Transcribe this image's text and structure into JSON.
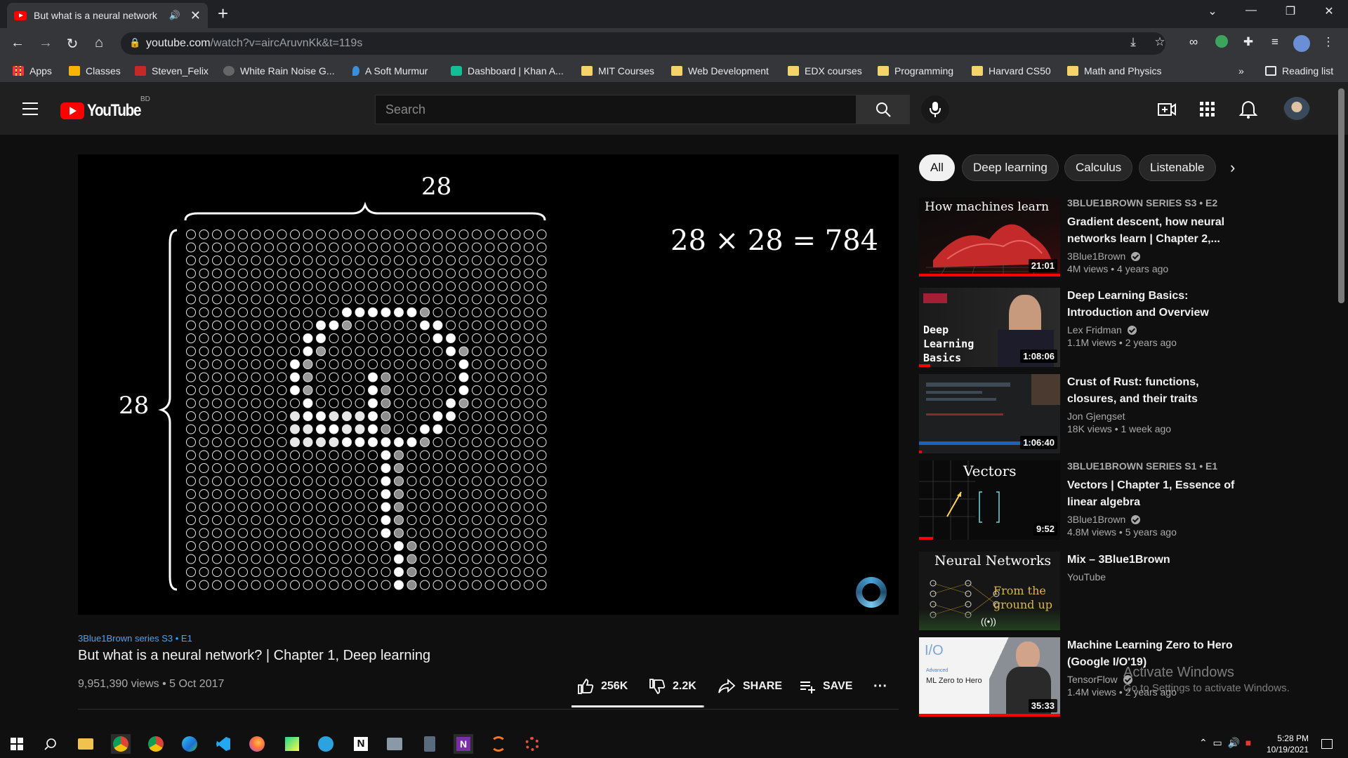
{
  "browser": {
    "tab_title": "But what is a neural network",
    "url_host": "youtube.com",
    "url_path": "/watch?v=aircAruvnKk&t=119s",
    "bookmarks": [
      {
        "label": "Apps",
        "type": "grid"
      },
      {
        "label": "Classes",
        "type": "classroom"
      },
      {
        "label": "Steven_Felix",
        "type": "uva"
      },
      {
        "label": "White Rain Noise G...",
        "type": "noise"
      },
      {
        "label": "A Soft Murmur",
        "type": "drop"
      },
      {
        "label": "Dashboard | Khan A...",
        "type": "khan"
      },
      {
        "label": "MIT Courses",
        "type": "folder"
      },
      {
        "label": "Web Development",
        "type": "folder"
      },
      {
        "label": "EDX courses",
        "type": "folder"
      },
      {
        "label": "Programming",
        "type": "folder"
      },
      {
        "label": "Harvard CS50",
        "type": "folder"
      },
      {
        "label": "Math and Physics",
        "type": "folder"
      }
    ],
    "more_bookmarks": "»",
    "reading_list": "Reading list"
  },
  "header": {
    "logo_text": "YouTube",
    "region": "BD",
    "search_placeholder": "Search"
  },
  "player": {
    "dim_top": "28",
    "dim_left": "28",
    "equation": "28 × 28 = 784"
  },
  "video": {
    "series": "3Blue1Brown series  S3 • E1",
    "title": "But what is a neural network? | Chapter 1, Deep learning",
    "meta": "9,951,390 views • 5 Oct 2017",
    "likes": "256K",
    "dislikes": "2.2K",
    "share": "SHARE",
    "save": "SAVE",
    "more": "···"
  },
  "chips": [
    "All",
    "Deep learning",
    "Calculus",
    "Listenable"
  ],
  "recommendations": [
    {
      "label": "3BLUE1BROWN SERIES  S3 • E2",
      "title": "Gradient descent, how neural networks learn | Chapter 2,...",
      "channel": "3Blue1Brown",
      "verified": true,
      "stats": "4M views • 4 years ago",
      "duration": "21:01",
      "thumb_text": "How machines learn",
      "progress": 1.0
    },
    {
      "label": "",
      "title": "Deep Learning Basics: Introduction and Overview",
      "channel": "Lex Fridman",
      "verified": true,
      "stats": "1.1M views • 2 years ago",
      "duration": "1:08:06",
      "thumb_text": "Deep Learning Basics",
      "progress": 0.08
    },
    {
      "label": "",
      "title": "Crust of Rust: functions, closures, and their traits",
      "channel": "Jon Gjengset",
      "verified": false,
      "stats": "18K views • 1 week ago",
      "duration": "1:06:40",
      "thumb_text": "",
      "progress": 0.02
    },
    {
      "label": "3BLUE1BROWN SERIES  S1 • E1",
      "title": "Vectors | Chapter 1, Essence of linear algebra",
      "channel": "3Blue1Brown",
      "verified": true,
      "stats": "4.8M views • 5 years ago",
      "duration": "9:52",
      "thumb_text": "Vectors",
      "progress": 0.1
    },
    {
      "label": "",
      "title": "Mix – 3Blue1Brown",
      "channel": "YouTube",
      "verified": false,
      "stats": "",
      "duration": "",
      "thumb_text": "Neural Networks",
      "thumb_text2": "From the ground up",
      "progress": 0
    },
    {
      "label": "",
      "title": "Machine Learning Zero to Hero (Google I/O'19)",
      "channel": "TensorFlow",
      "verified": true,
      "stats": "1.4M views • 2 years ago",
      "duration": "35:33",
      "thumb_text": "ML Zero to Hero",
      "thumb_text2": "Advanced",
      "progress": 1.0
    }
  ],
  "watermark": {
    "line1": "Activate Windows",
    "line2": "Go to Settings to activate Windows."
  },
  "taskbar": {
    "time": "5:28 PM",
    "date": "10/19/2021"
  },
  "colors": {
    "yt_red": "#ff0000",
    "link_blue": "#3ea6ff",
    "bg": "#0f0f0f"
  }
}
